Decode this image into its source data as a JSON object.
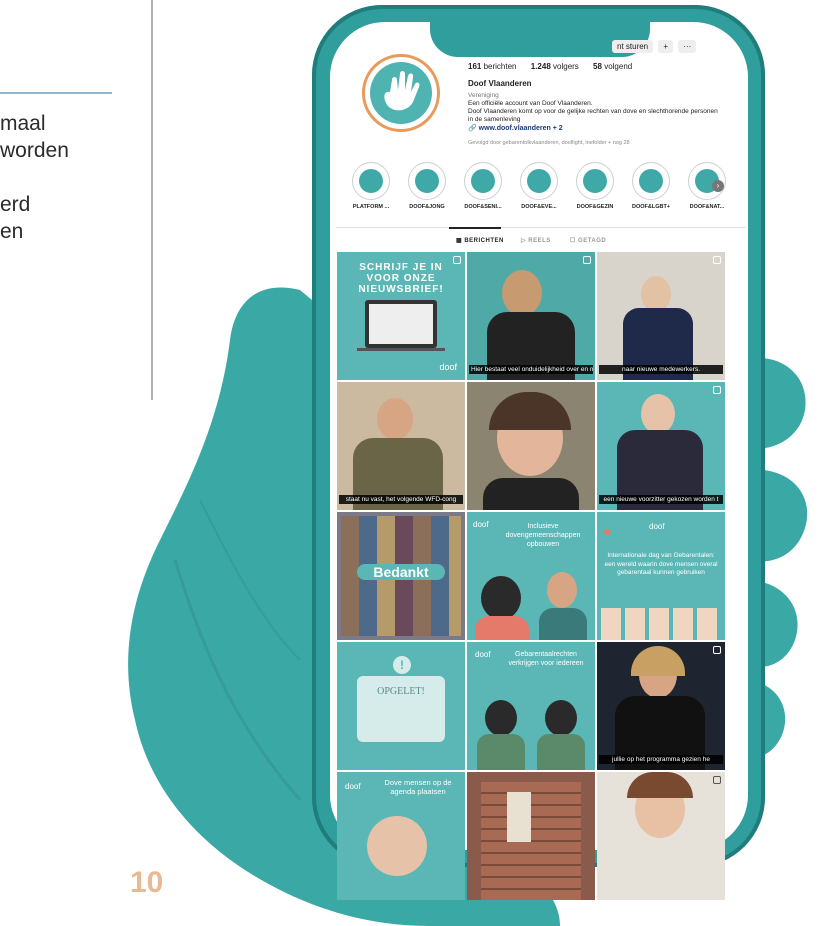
{
  "left_text": {
    "lines": [
      "maal",
      "worden",
      "",
      "erd",
      "en"
    ]
  },
  "page_number": "10",
  "phone": {
    "top_buttons": [
      "nt sturen",
      "+ߍ",
      "···"
    ],
    "profile": {
      "posts_count": "161",
      "posts_label": "berichten",
      "followers_count": "1.248",
      "followers_label": "volgers",
      "following_count": "58",
      "following_label": "volgend",
      "name": "Doof Vlaanderen",
      "category": "Vereniging",
      "bio_line1": "Een officiële account van Doof Vlaanderen.",
      "bio_line2": "Doof Vlaanderen komt op voor de gelijke rechten van dove en slechthorende personen in de samenleving",
      "link": "www.doof.vlaanderen + 2",
      "followed_by": "Gevolgd door gebarentolkvlaanderen, dooflight, inefolder + nog 28"
    },
    "highlights": [
      {
        "label": "PLATFORM ..."
      },
      {
        "label": "DOOF&JONG"
      },
      {
        "label": "DOOF&SENI..."
      },
      {
        "label": "DOOF&EVE..."
      },
      {
        "label": "DOOF&GEZIN"
      },
      {
        "label": "DOOF&LGBT+"
      },
      {
        "label": "DOOF&NAT..."
      }
    ],
    "tabs": [
      {
        "label": "BERICHTEN"
      },
      {
        "label": "REELS"
      },
      {
        "label": "GETAGD"
      }
    ],
    "posts": [
      {
        "title": "SCHRIJF JE IN VOOR ONZE NIEUWSBRIEF!",
        "caption": "",
        "brand": "doof"
      },
      {
        "title": "",
        "caption": "Hier bestaat veel onduidelijkheid over en men vraagt hoe het nu juist zit."
      },
      {
        "title": "",
        "caption": "naar nieuwe medewerkers."
      },
      {
        "title": "",
        "caption": "staat nu vast, het volgende WFD-cong"
      },
      {
        "title": "",
        "caption": ""
      },
      {
        "title": "",
        "caption": "een nieuwe voorzitter gekozen worden t"
      },
      {
        "title": "Bedankt",
        "caption": ""
      },
      {
        "title": "Inclusieve dovengemeenschappen opbouwen",
        "caption": "",
        "brand": "doof"
      },
      {
        "title": "Internationale dag van Gebarentalen: een wereld waarin dove mensen overal gebarentaal kunnen gebruiken",
        "caption": "",
        "brand": "doof"
      },
      {
        "title": "OPGELET!",
        "caption": ""
      },
      {
        "title": "Gebarentaalrechten verkrijgen voor iedereen",
        "caption": "",
        "brand": "doof"
      },
      {
        "title": "",
        "caption": "jullie op het programma gezien he"
      },
      {
        "title": "Dove mensen op de agenda plaatsen",
        "caption": "",
        "brand": "doof"
      },
      {
        "title": "",
        "caption": ""
      },
      {
        "title": "",
        "caption": ""
      }
    ]
  },
  "colors": {
    "teal": "#2f9e9c",
    "teal_light": "#5bb7b5",
    "hand": "#3aa8a4",
    "page_number": "#e8b992"
  }
}
